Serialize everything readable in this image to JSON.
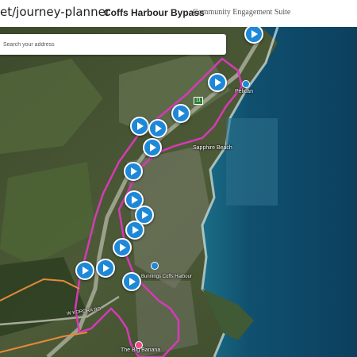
{
  "header": {
    "url_fragment": "et/journey-planner",
    "title": "Coffs Harbour Bypass",
    "subtitle": "Community Engagement Suite"
  },
  "search": {
    "placeholder": "Search your address"
  },
  "map": {
    "labels": {
      "sapphire": "Sapphire Beach",
      "pelican": "Pelican",
      "bigbanana": "The Big Banana",
      "korora": "W KORORA RD",
      "bunnings": "Bunnings Coffs Harbour",
      "road_shield": "11"
    },
    "colors": {
      "route_outline": "#d63ab8",
      "alt_route": "#e58a3a",
      "pin": "#1e88d8",
      "ocean": "#0f4a6e"
    },
    "pins": [
      {
        "id": "pin-1",
        "icon": "play-icon"
      },
      {
        "id": "pin-2",
        "icon": "play-icon"
      },
      {
        "id": "pin-3",
        "icon": "play-icon"
      },
      {
        "id": "pin-4",
        "icon": "play-icon"
      },
      {
        "id": "pin-5",
        "icon": "play-icon"
      },
      {
        "id": "pin-6",
        "icon": "play-icon"
      },
      {
        "id": "pin-7",
        "icon": "play-icon"
      },
      {
        "id": "pin-8",
        "icon": "play-icon"
      },
      {
        "id": "pin-9",
        "icon": "play-icon"
      },
      {
        "id": "pin-10",
        "icon": "play-icon"
      },
      {
        "id": "pin-11",
        "icon": "play-icon"
      },
      {
        "id": "pin-12",
        "icon": "play-icon"
      },
      {
        "id": "pin-13",
        "icon": "play-icon"
      },
      {
        "id": "pin-14",
        "icon": "play-icon"
      }
    ]
  }
}
